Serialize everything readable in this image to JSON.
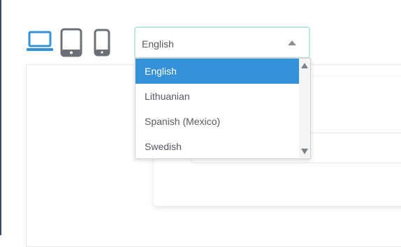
{
  "toolbar": {
    "devices": [
      {
        "icon": "laptop-icon",
        "active": true,
        "color": "#3592d8"
      },
      {
        "icon": "tablet-icon",
        "active": false,
        "color": "#6b7076"
      },
      {
        "icon": "phone-icon",
        "active": false,
        "color": "#6b7076"
      }
    ]
  },
  "language_select": {
    "value": "English",
    "options": [
      "English",
      "Lithuanian",
      "Spanish (Mexico)",
      "Swedish"
    ],
    "selected_index": 0,
    "highlight_color": "#3592d8",
    "focus_border_color": "#bfe8dc"
  }
}
